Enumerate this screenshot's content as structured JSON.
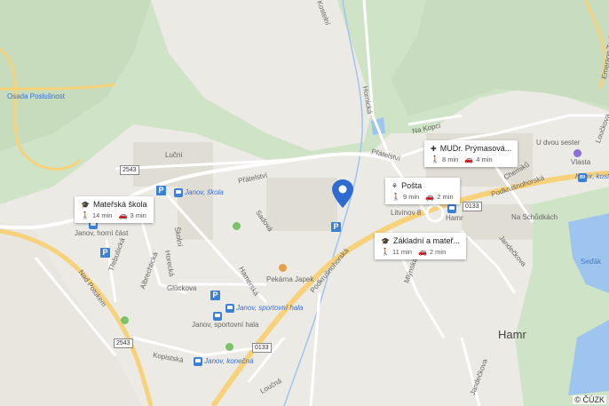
{
  "map": {
    "copyright": "© ČÚZK",
    "town_label": "Hamr",
    "streets": {
      "lucni": "Luční",
      "pratelstvi": "Přátelství",
      "pratelstvi2": "Přátelství",
      "sadova": "Sadová",
      "hamerska": "Hamerská",
      "glucksova": "Glückova",
      "albrechticka": "Albrechtická",
      "trebusicka": "Třebušická",
      "horecka": "Horecká",
      "skolni": "Školní",
      "nad_potokem": "Nad Potokem",
      "kopistska": "Kopistská",
      "hornicka": "Hornická",
      "na_kopci": "Na Kopci",
      "podkrusnohorska": "Podkrušnohorská",
      "podkrusnohorska2": "Podkrušnohorská",
      "chemiku": "Chemiků",
      "mlynska": "Mlýnská",
      "jandeckova": "Jandečkova",
      "jandeckova2": "Jandečkova",
      "loucna": "Loučná",
      "emerson": "Emerson Trail",
      "louckova": "Loučkova",
      "osada_poslusnost": "Osada Poslušnost",
      "kostelni": "Kostelní"
    },
    "road_numbers": {
      "r1": "2543",
      "r2": "2543",
      "r3": "0133",
      "r4": "0133"
    },
    "places": {
      "janov_skola": "Janov, škola",
      "janov_horni_cast": "Janov, horní část",
      "janov_sportovni_hala": "Janov, sportovní hala",
      "janov_sportovni_hala2": "Janov, sportovní hala",
      "janov_konecna": "Janov, konečná",
      "pekarna": "Pekárna Japek",
      "litvinov8": "Litvínov 8",
      "hamr_stop": "Hamr",
      "u_dvou_sester": "U dvou sester",
      "vlasta": "Vlasta",
      "hamr_kostel": "Hamr, kostel",
      "na_schodkach": "Na Schůdkách",
      "sedak": "Seďák"
    },
    "cards": [
      {
        "title": "Mateřská škola",
        "walk": "14 min",
        "drive": "3 min",
        "icon": "school-icon"
      },
      {
        "title": "MUDr. Prýmasová...",
        "walk": "8 min",
        "drive": "4 min",
        "icon": "medical-icon"
      },
      {
        "title": "Pošta",
        "walk": "9 min",
        "drive": "2 min",
        "icon": "post-icon"
      },
      {
        "title": "Základní a mateř...",
        "walk": "11 min",
        "drive": "2 min",
        "icon": "school-icon"
      }
    ],
    "parking_label": "P"
  }
}
